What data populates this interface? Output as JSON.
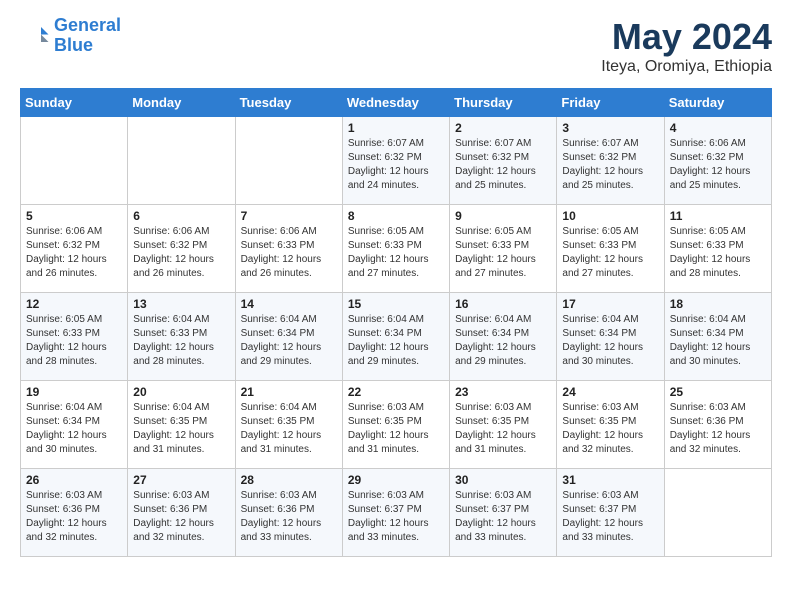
{
  "header": {
    "logo_line1": "General",
    "logo_line2": "Blue",
    "month": "May 2024",
    "location": "Iteya, Oromiya, Ethiopia"
  },
  "weekdays": [
    "Sunday",
    "Monday",
    "Tuesday",
    "Wednesday",
    "Thursday",
    "Friday",
    "Saturday"
  ],
  "weeks": [
    [
      {
        "day": "",
        "text": ""
      },
      {
        "day": "",
        "text": ""
      },
      {
        "day": "",
        "text": ""
      },
      {
        "day": "1",
        "text": "Sunrise: 6:07 AM\nSunset: 6:32 PM\nDaylight: 12 hours\nand 24 minutes."
      },
      {
        "day": "2",
        "text": "Sunrise: 6:07 AM\nSunset: 6:32 PM\nDaylight: 12 hours\nand 25 minutes."
      },
      {
        "day": "3",
        "text": "Sunrise: 6:07 AM\nSunset: 6:32 PM\nDaylight: 12 hours\nand 25 minutes."
      },
      {
        "day": "4",
        "text": "Sunrise: 6:06 AM\nSunset: 6:32 PM\nDaylight: 12 hours\nand 25 minutes."
      }
    ],
    [
      {
        "day": "5",
        "text": "Sunrise: 6:06 AM\nSunset: 6:32 PM\nDaylight: 12 hours\nand 26 minutes."
      },
      {
        "day": "6",
        "text": "Sunrise: 6:06 AM\nSunset: 6:32 PM\nDaylight: 12 hours\nand 26 minutes."
      },
      {
        "day": "7",
        "text": "Sunrise: 6:06 AM\nSunset: 6:33 PM\nDaylight: 12 hours\nand 26 minutes."
      },
      {
        "day": "8",
        "text": "Sunrise: 6:05 AM\nSunset: 6:33 PM\nDaylight: 12 hours\nand 27 minutes."
      },
      {
        "day": "9",
        "text": "Sunrise: 6:05 AM\nSunset: 6:33 PM\nDaylight: 12 hours\nand 27 minutes."
      },
      {
        "day": "10",
        "text": "Sunrise: 6:05 AM\nSunset: 6:33 PM\nDaylight: 12 hours\nand 27 minutes."
      },
      {
        "day": "11",
        "text": "Sunrise: 6:05 AM\nSunset: 6:33 PM\nDaylight: 12 hours\nand 28 minutes."
      }
    ],
    [
      {
        "day": "12",
        "text": "Sunrise: 6:05 AM\nSunset: 6:33 PM\nDaylight: 12 hours\nand 28 minutes."
      },
      {
        "day": "13",
        "text": "Sunrise: 6:04 AM\nSunset: 6:33 PM\nDaylight: 12 hours\nand 28 minutes."
      },
      {
        "day": "14",
        "text": "Sunrise: 6:04 AM\nSunset: 6:34 PM\nDaylight: 12 hours\nand 29 minutes."
      },
      {
        "day": "15",
        "text": "Sunrise: 6:04 AM\nSunset: 6:34 PM\nDaylight: 12 hours\nand 29 minutes."
      },
      {
        "day": "16",
        "text": "Sunrise: 6:04 AM\nSunset: 6:34 PM\nDaylight: 12 hours\nand 29 minutes."
      },
      {
        "day": "17",
        "text": "Sunrise: 6:04 AM\nSunset: 6:34 PM\nDaylight: 12 hours\nand 30 minutes."
      },
      {
        "day": "18",
        "text": "Sunrise: 6:04 AM\nSunset: 6:34 PM\nDaylight: 12 hours\nand 30 minutes."
      }
    ],
    [
      {
        "day": "19",
        "text": "Sunrise: 6:04 AM\nSunset: 6:34 PM\nDaylight: 12 hours\nand 30 minutes."
      },
      {
        "day": "20",
        "text": "Sunrise: 6:04 AM\nSunset: 6:35 PM\nDaylight: 12 hours\nand 31 minutes."
      },
      {
        "day": "21",
        "text": "Sunrise: 6:04 AM\nSunset: 6:35 PM\nDaylight: 12 hours\nand 31 minutes."
      },
      {
        "day": "22",
        "text": "Sunrise: 6:03 AM\nSunset: 6:35 PM\nDaylight: 12 hours\nand 31 minutes."
      },
      {
        "day": "23",
        "text": "Sunrise: 6:03 AM\nSunset: 6:35 PM\nDaylight: 12 hours\nand 31 minutes."
      },
      {
        "day": "24",
        "text": "Sunrise: 6:03 AM\nSunset: 6:35 PM\nDaylight: 12 hours\nand 32 minutes."
      },
      {
        "day": "25",
        "text": "Sunrise: 6:03 AM\nSunset: 6:36 PM\nDaylight: 12 hours\nand 32 minutes."
      }
    ],
    [
      {
        "day": "26",
        "text": "Sunrise: 6:03 AM\nSunset: 6:36 PM\nDaylight: 12 hours\nand 32 minutes."
      },
      {
        "day": "27",
        "text": "Sunrise: 6:03 AM\nSunset: 6:36 PM\nDaylight: 12 hours\nand 32 minutes."
      },
      {
        "day": "28",
        "text": "Sunrise: 6:03 AM\nSunset: 6:36 PM\nDaylight: 12 hours\nand 33 minutes."
      },
      {
        "day": "29",
        "text": "Sunrise: 6:03 AM\nSunset: 6:37 PM\nDaylight: 12 hours\nand 33 minutes."
      },
      {
        "day": "30",
        "text": "Sunrise: 6:03 AM\nSunset: 6:37 PM\nDaylight: 12 hours\nand 33 minutes."
      },
      {
        "day": "31",
        "text": "Sunrise: 6:03 AM\nSunset: 6:37 PM\nDaylight: 12 hours\nand 33 minutes."
      },
      {
        "day": "",
        "text": ""
      }
    ]
  ]
}
